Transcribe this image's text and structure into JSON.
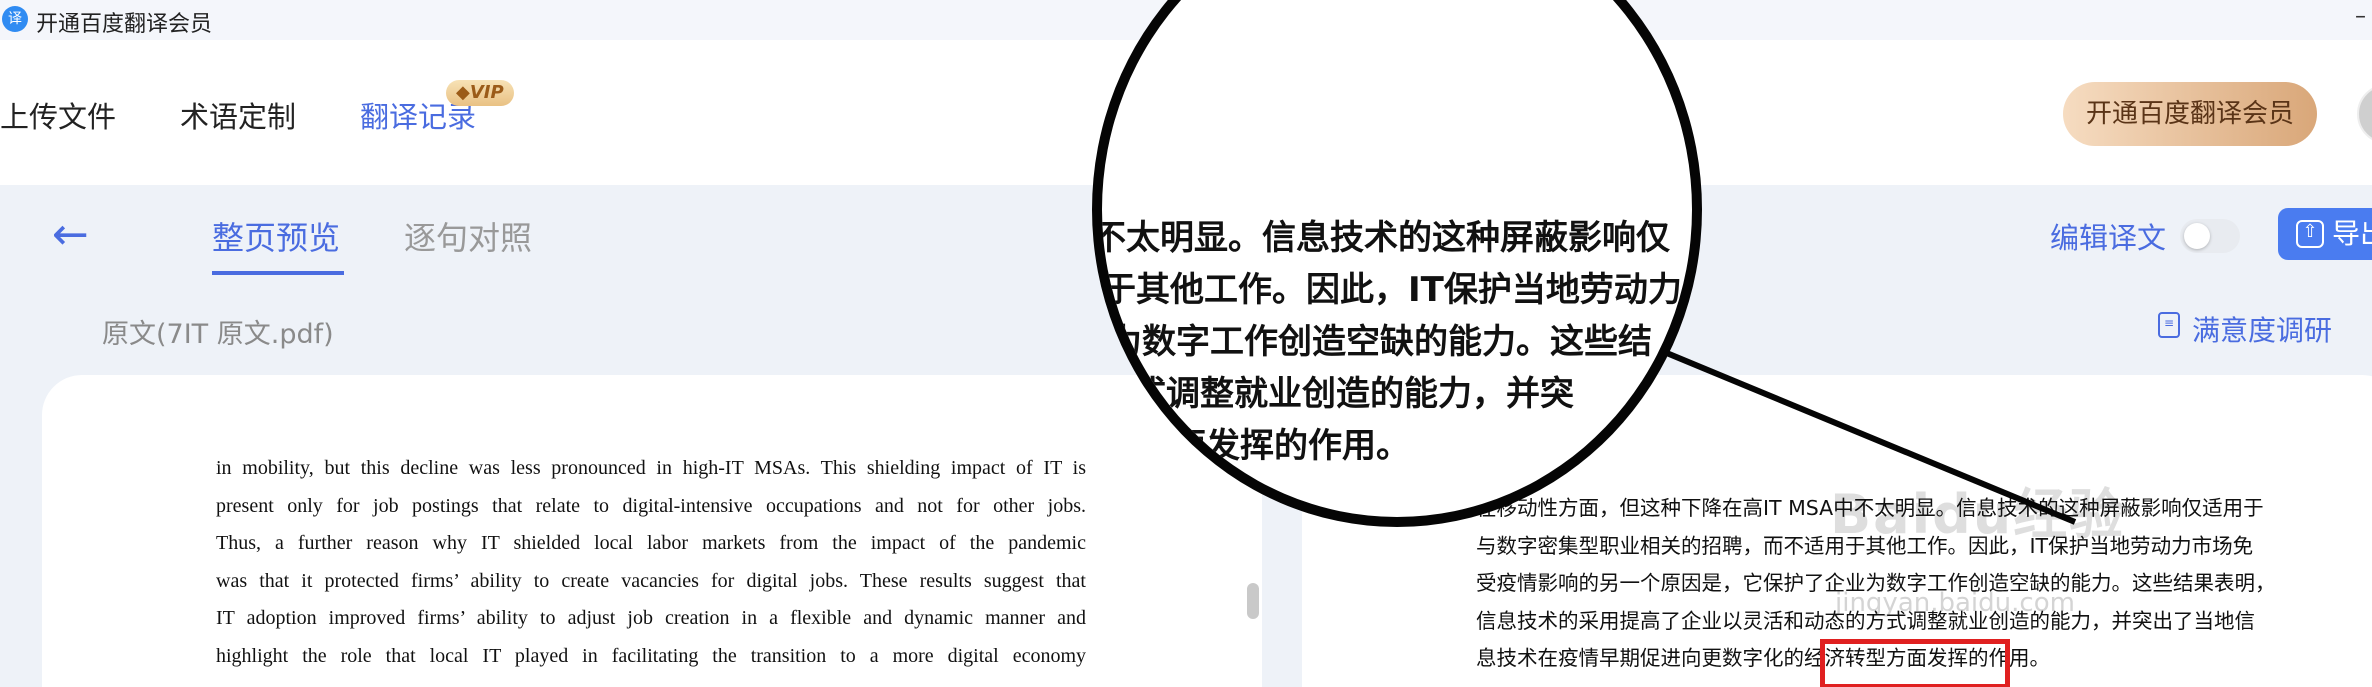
{
  "titlebar": {
    "logo_char": "译",
    "title": "开通百度翻译会员",
    "minimize": "–"
  },
  "nav": {
    "items": [
      "上传文件",
      "术语定制",
      "翻译记录"
    ],
    "vip_badge": "VIP",
    "member_button": "开通百度翻译会员"
  },
  "subnav": {
    "back": "←",
    "tabs": [
      "整页预览",
      "逐句对照"
    ],
    "edit_label": "编辑译文",
    "export_label": "导出",
    "export_icon": "⇧"
  },
  "file": {
    "name": "原文(7IT 原文.pdf)",
    "survey_label": "满意度调研",
    "survey_icon": "≡"
  },
  "source_lines": [
    "in mobility, but this decline was less pronounced in high-IT MSAs. This shielding impact of IT is",
    "present only for job postings that relate to digital-intensive occupations and not for other jobs.",
    "Thus, a further reason why IT shielded local labor markets from the impact of the pandemic",
    "was that it protected firms’ ability to create vacancies for digital jobs. These results suggest that",
    "IT adoption improved firms’ ability to adjust job creation in a flexible and dynamic manner and",
    "highlight the role that local IT played in facilitating the transition to a more digital economy"
  ],
  "translation_lines": [
    "在移动性方面，但这种下降在高IT MSA中不太明显。信息技术的这种屏蔽影响仅适用于",
    "与数字密集型职业相关的招聘，而不适用于其他工作。因此，IT保护当地劳动力市场免",
    "受疫情影响的另一个原因是，它保护了企业为数字工作创造空缺的能力。这些结果表明，",
    "信息技术的采用提高了企业以灵活和动态的方式调整就业创造的能力，并突出了当地信",
    "息技术在疫情早期促进向更数字化的经济转型方面发挥的作用。"
  ],
  "magnifier_lines": [
    "不太明显。信息技术的这种屏蔽影响仅",
    "于其他工作。因此，IT保护当地劳动力",
    "为数字工作创造空缺的能力。这些结",
    "式调整就业创造的能力，并突",
    "面发挥的作用。"
  ],
  "watermark": {
    "line1": "Baidu经验",
    "line2": "jingyan.baidu.com"
  },
  "colors": {
    "accent": "#4a6ce0",
    "highlight": "#e02020"
  }
}
